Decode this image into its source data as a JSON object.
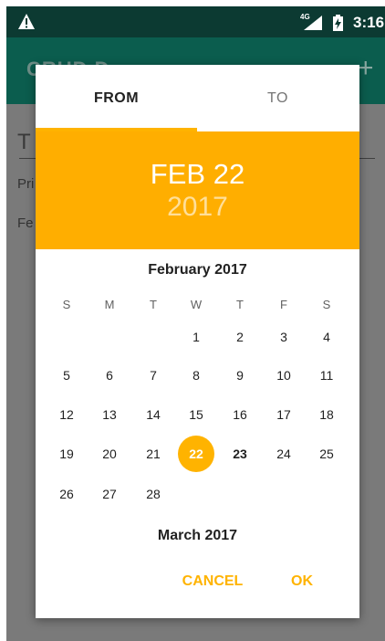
{
  "status_bar": {
    "network_label": "4G",
    "time": "3:16"
  },
  "app_bar": {
    "title": "CRUD D",
    "add_label": "+"
  },
  "background": {
    "field_text": "T",
    "label_1": "Pri",
    "label_2": "Fe"
  },
  "dialog": {
    "tabs": [
      {
        "label": "FROM",
        "selected": true
      },
      {
        "label": "TO",
        "selected": false
      }
    ],
    "header": {
      "date": "FEB 22",
      "year": "2017"
    },
    "current_month": "February 2017",
    "next_month": "March 2017",
    "weekdays": [
      "S",
      "M",
      "T",
      "W",
      "T",
      "F",
      "S"
    ],
    "days": [
      [
        "",
        "",
        "",
        "1",
        "2",
        "3",
        "4"
      ],
      [
        "5",
        "6",
        "7",
        "8",
        "9",
        "10",
        "11"
      ],
      [
        "12",
        "13",
        "14",
        "15",
        "16",
        "17",
        "18"
      ],
      [
        "19",
        "20",
        "21",
        "22",
        "23",
        "24",
        "25"
      ],
      [
        "26",
        "27",
        "28",
        "",
        "",
        "",
        ""
      ]
    ],
    "selected_day": "22",
    "today": "23",
    "cancel_label": "CANCEL",
    "ok_label": "OK"
  },
  "colors": {
    "accent": "#ffb300",
    "header_bg": "#ffae00",
    "status_bar": "#0c3a32",
    "app_bar": "#0b5d4e"
  }
}
